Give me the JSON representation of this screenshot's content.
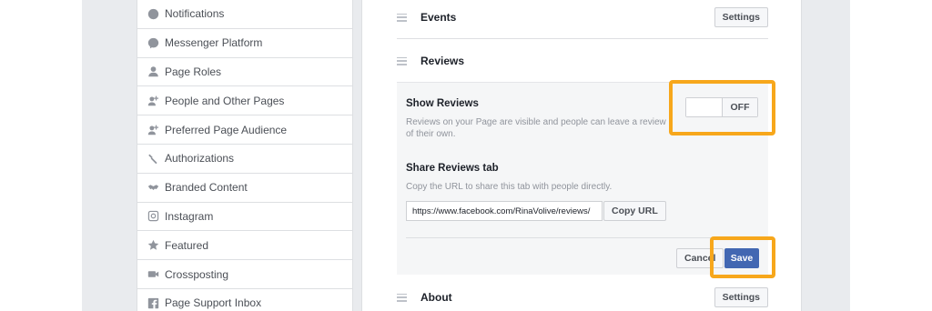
{
  "sidebar": {
    "items": [
      {
        "label": "Notifications",
        "icon": "globe-icon"
      },
      {
        "label": "Messenger Platform",
        "icon": "messenger-icon"
      },
      {
        "label": "Page Roles",
        "icon": "person-icon"
      },
      {
        "label": "People and Other Pages",
        "icon": "people-icon"
      },
      {
        "label": "Preferred Page Audience",
        "icon": "people-icon"
      },
      {
        "label": "Authorizations",
        "icon": "wrench-icon"
      },
      {
        "label": "Branded Content",
        "icon": "handshake-icon"
      },
      {
        "label": "Instagram",
        "icon": "instagram-icon"
      },
      {
        "label": "Featured",
        "icon": "star-icon"
      },
      {
        "label": "Crossposting",
        "icon": "video-camera-icon"
      },
      {
        "label": "Page Support Inbox",
        "icon": "facebook-icon"
      }
    ]
  },
  "main": {
    "events": {
      "title": "Events",
      "settings_label": "Settings"
    },
    "reviews": {
      "title": "Reviews",
      "show_reviews_label": "Show Reviews",
      "show_reviews_desc": "Reviews on your Page are visible and people can leave a review of their own.",
      "toggle_state": "OFF",
      "share_tab_label": "Share Reviews tab",
      "share_tab_desc": "Copy the URL to share this tab with people directly.",
      "url_value": "https://www.facebook.com/RinaVolive/reviews/",
      "copy_url_label": "Copy URL",
      "cancel_label": "Cancel",
      "save_label": "Save"
    },
    "about": {
      "title": "About",
      "settings_label": "Settings"
    }
  },
  "colors": {
    "highlight": "#f7a71b",
    "primary_button": "#4267b2",
    "page_background": "#e9ebee"
  }
}
